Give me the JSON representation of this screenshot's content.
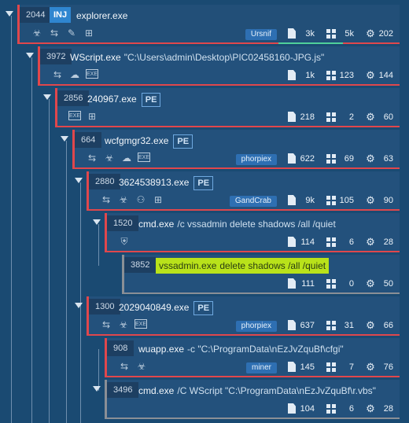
{
  "colors": {
    "background": "#1a4a72",
    "node": "#23517c",
    "accent_red": "#e0474c",
    "accent_gray": "#8a8f96",
    "highlight": "#b9e21a",
    "inj_badge": "#2f86d0",
    "family_badge": "#2e6fb2"
  },
  "processes": [
    {
      "pid": "2044",
      "inj": "INJ",
      "name": "explorer.exe",
      "args": "",
      "pe": "",
      "family": "Ursnif",
      "icons": [
        "biohazard",
        "arrows",
        "syringe",
        "network-grid"
      ],
      "files": "3k",
      "registry": "5k",
      "modules": "202",
      "progress": 0.17
    },
    {
      "pid": "3972",
      "name": "WScript.exe",
      "args": "\"C:\\Users\\admin\\Desktop\\PIC02458160-JPG.js\"",
      "pe": "",
      "family": "",
      "icons": [
        "arrows",
        "cloud-network",
        "exe"
      ],
      "files": "1k",
      "registry": "123",
      "modules": "144"
    },
    {
      "pid": "2856",
      "name": "240967.exe",
      "args": "",
      "pe": "PE",
      "family": "",
      "icons": [
        "exe",
        "network-grid"
      ],
      "files": "218",
      "registry": "2",
      "modules": "60"
    },
    {
      "pid": "664",
      "name": "wcfgmgr32.exe",
      "args": "",
      "pe": "PE",
      "family": "phorpiex",
      "icons": [
        "arrows",
        "biohazard",
        "cloud-network",
        "exe"
      ],
      "files": "622",
      "registry": "69",
      "modules": "63"
    },
    {
      "pid": "2880",
      "name": "3624538913.exe",
      "args": "",
      "pe": "PE",
      "family": "GandCrab",
      "icons": [
        "arrows",
        "biohazard",
        "spy",
        "network-grid"
      ],
      "files": "9k",
      "registry": "105",
      "modules": "90"
    },
    {
      "pid": "1520",
      "name": "cmd.exe",
      "args": "/c vssadmin delete shadows /all /quiet",
      "pe": "",
      "family": "",
      "icons": [
        "shield"
      ],
      "files": "114",
      "registry": "6",
      "modules": "28"
    },
    {
      "pid": "3852",
      "name": "vssadmin.exe",
      "args": "delete shadows /all /quiet",
      "pe": "",
      "family": "",
      "icons": [],
      "files": "111",
      "registry": "0",
      "modules": "50"
    },
    {
      "pid": "1300",
      "name": "2029040849.exe",
      "args": "",
      "pe": "PE",
      "family": "phorpiex",
      "icons": [
        "arrows",
        "biohazard",
        "exe"
      ],
      "files": "637",
      "registry": "31",
      "modules": "66"
    },
    {
      "pid": "908",
      "name": "wuapp.exe",
      "args": "-c \"C:\\ProgramData\\nEzJvZquBf\\cfgi\"",
      "pe": "",
      "family": "miner",
      "icons": [
        "arrows",
        "biohazard"
      ],
      "files": "145",
      "registry": "7",
      "modules": "76"
    },
    {
      "pid": "3496",
      "name": "cmd.exe",
      "args": "/C WScript \"C:\\ProgramData\\nEzJvZquBf\\r.vbs\"",
      "pe": "",
      "family": "",
      "icons": [],
      "files": "104",
      "registry": "6",
      "modules": "28"
    }
  ]
}
